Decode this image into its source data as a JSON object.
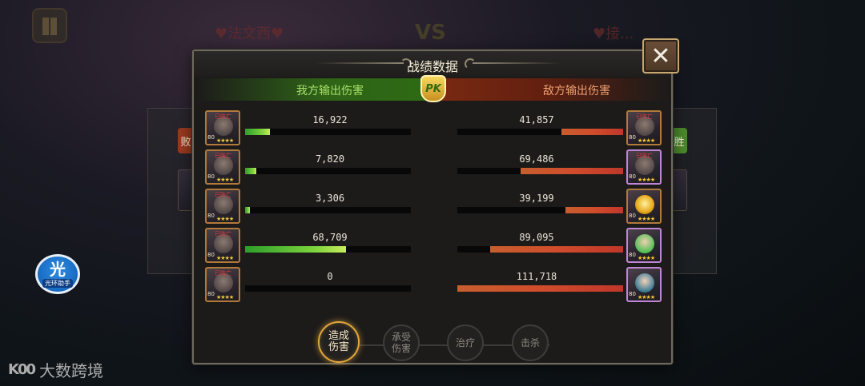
{
  "background": {
    "left_player": "♥法文西♥",
    "vs": "VS",
    "right_player": "♥接...",
    "lose_tag": "败",
    "win_tag": "胜",
    "helper_icon": "光",
    "helper_label": "光环助手"
  },
  "watermark": {
    "logo": "K00",
    "text": "大数跨境"
  },
  "panel": {
    "title": "战绩数据",
    "ally_header": "我方输出伤害",
    "enemy_header": "敌方输出伤害",
    "pk_badge": "PK",
    "close_icon": "close-icon"
  },
  "rows": [
    {
      "ally": {
        "value": "16,922",
        "ratio": 0.15,
        "level": "80",
        "stars": "★★★★",
        "status": "已阵亡"
      },
      "enemy": {
        "value": "41,857",
        "ratio": 0.37,
        "level": "80",
        "stars": "★★★★",
        "status": "已阵亡"
      }
    },
    {
      "ally": {
        "value": "7,820",
        "ratio": 0.07,
        "level": "80",
        "stars": "★★★★",
        "status": "已阵亡"
      },
      "enemy": {
        "value": "69,486",
        "ratio": 0.62,
        "level": "80",
        "stars": "★★★★",
        "status": "已阵亡"
      }
    },
    {
      "ally": {
        "value": "3,306",
        "ratio": 0.03,
        "level": "80",
        "stars": "★★★★",
        "status": "已阵亡"
      },
      "enemy": {
        "value": "39,199",
        "ratio": 0.35,
        "level": "80",
        "stars": "★★★★",
        "status": ""
      }
    },
    {
      "ally": {
        "value": "68,709",
        "ratio": 0.61,
        "level": "80",
        "stars": "★★★★",
        "status": "已阵亡"
      },
      "enemy": {
        "value": "89,095",
        "ratio": 0.8,
        "level": "80",
        "stars": "★★★★",
        "status": ""
      }
    },
    {
      "ally": {
        "value": "0",
        "ratio": 0.0,
        "level": "80",
        "stars": "★★★★",
        "status": "已阵亡"
      },
      "enemy": {
        "value": "111,718",
        "ratio": 1.0,
        "level": "80",
        "stars": "★★★★",
        "status": ""
      }
    }
  ],
  "tabs": [
    {
      "label": "造成\n伤害",
      "active": true
    },
    {
      "label": "承受\n伤害",
      "active": false
    },
    {
      "label": "治疗",
      "active": false
    },
    {
      "label": "击杀",
      "active": false
    }
  ],
  "colors": {
    "ally_bar": "#7fd43c",
    "enemy_bar": "#d04d2b",
    "active_tab": "#e2a63a"
  }
}
